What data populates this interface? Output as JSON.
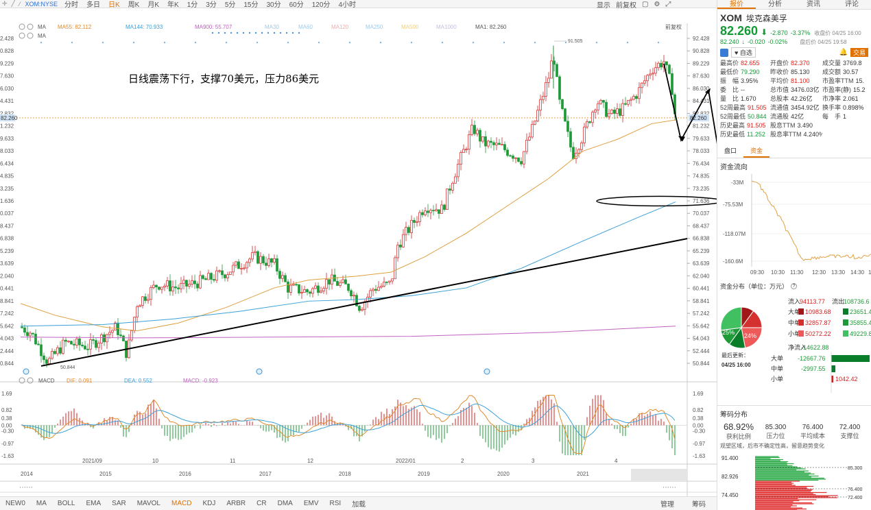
{
  "toolbar": {
    "symbol": "XOM:NYSE",
    "periods": [
      "分时",
      "多日",
      "日K",
      "周K",
      "月K",
      "年K",
      "1分",
      "3分",
      "5分",
      "15分",
      "30分",
      "60分",
      "120分",
      "4小时"
    ],
    "active_period": "日K",
    "right": [
      "显示",
      "前复权"
    ]
  },
  "main_chart": {
    "ma_legend": [
      {
        "label": "MA",
        "color": "#555"
      },
      {
        "label": "MA55: 82.112",
        "color": "#e08a2a"
      },
      {
        "label": "MA144: 70.933",
        "color": "#3aa0d8"
      },
      {
        "label": "MA900: 55.707",
        "color": "#c060c0"
      },
      {
        "label": "MA30",
        "color": "#9ec9e8"
      },
      {
        "label": "MA60",
        "color": "#9ec9e8"
      },
      {
        "label": "MA120",
        "color": "#e8b0b0"
      },
      {
        "label": "MA250",
        "color": "#9ec9e8"
      },
      {
        "label": "MA500",
        "color": "#f0d080"
      },
      {
        "label": "MA1000",
        "color": "#c0c0e0"
      },
      {
        "label": "MA1: 82.260",
        "color": "#555"
      }
    ],
    "ma_legend2": "MA",
    "fq_label": "前复权",
    "annotation": "日线震荡下行，支撑70美元，压力86美元",
    "y_ticks": [
      "92.428",
      "90.828",
      "89.229",
      "87.630",
      "86.030",
      "84.431",
      "82.832",
      "81.232",
      "79.633",
      "78.033",
      "76.434",
      "74.835",
      "73.235",
      "71.636",
      "70.037",
      "68.437",
      "66.838",
      "65.239",
      "63.639",
      "62.040",
      "60.441",
      "58.841",
      "57.242",
      "55.642",
      "54.043",
      "52.444",
      "50.844"
    ],
    "left_ticks": [
      "2.428",
      "0.828",
      "9.229",
      "7.630",
      "6.030",
      "4.431",
      "2.832",
      "1.232",
      "9.633",
      "8.033",
      "6.434",
      "4.835",
      "3.235",
      "1.636",
      "0.037",
      "8.437",
      "6.838",
      "5.239",
      "3.639",
      "2.040",
      "0.441",
      "8.841",
      "7.242",
      "5.642",
      "4.043",
      "2.444",
      "0.844"
    ],
    "current_price": "82.260",
    "high_label": "91.505",
    "low_label": "50.844"
  },
  "macd": {
    "title": "MACD",
    "dif": "DIF: 0.091",
    "dea": "DEA: 0.552",
    "macd": "MACD: -0.923",
    "y_ticks": [
      "1.69",
      "0.82",
      "0.38",
      "0.00",
      "-0.30",
      "-0.97",
      "-1.63"
    ]
  },
  "x_axis": {
    "labels_top": [
      "2021/09",
      "10",
      "11",
      "12",
      "2022/01",
      "2",
      "3",
      "4"
    ],
    "labels_bottom": [
      "2014",
      "2015",
      "2016",
      "2017",
      "2018",
      "2019",
      "2020",
      "2021",
      "2022"
    ]
  },
  "indicators": [
    "NEW0",
    "MA",
    "BOLL",
    "EMA",
    "SAR",
    "MAVOL",
    "MACD",
    "KDJ",
    "ARBR",
    "CR",
    "DMA",
    "EMV",
    "RSI",
    "加载"
  ],
  "active_indicator": "MACD",
  "bottom_right": [
    "管理",
    "筹码"
  ],
  "right_panel": {
    "tabs": [
      "报价",
      "分析",
      "资讯",
      "评论"
    ],
    "ticker": "XOM",
    "name": "埃克森美孚",
    "price": "82.260",
    "change": "-2.870",
    "pct": "-3.37%",
    "close_label": "收盘价 04/25 16:00",
    "after_price": "82.240",
    "after_change": "-0.020",
    "after_pct": "-0.02%",
    "after_label": "盘后价 04/25 19:58",
    "buttons": [
      "自选",
      "交易"
    ],
    "quotes": [
      [
        [
          "最高价",
          "82.655",
          "red"
        ],
        [
          "开盘价",
          "82.370",
          "red"
        ],
        [
          "成交量",
          "3769.8",
          "none"
        ]
      ],
      [
        [
          "最低价",
          "79.290",
          "green"
        ],
        [
          "昨收价",
          "85.130",
          "none"
        ],
        [
          "成交额",
          "30.57",
          "none"
        ]
      ],
      [
        [
          "振　幅",
          "3.95%",
          "none"
        ],
        [
          "平均价",
          "81.100",
          "red"
        ],
        [
          "市盈率TTM",
          "15.",
          "none"
        ]
      ],
      [
        [
          "委　比",
          "--",
          "none"
        ],
        [
          "总市值",
          "3476.03亿",
          "none"
        ],
        [
          "市盈率(静)",
          "15.2",
          "none"
        ]
      ],
      [
        [
          "量　比",
          "1.670",
          "none"
        ],
        [
          "总股本",
          "42.26亿",
          "none"
        ],
        [
          "市净率",
          "2.061",
          "none"
        ]
      ],
      [
        [
          "52周最高",
          "91.505",
          "red"
        ],
        [
          "流通值",
          "3454.92亿",
          "none"
        ],
        [
          "换手率",
          "0.898%",
          "none"
        ]
      ],
      [
        [
          "52周最低",
          "50.844",
          "green"
        ],
        [
          "流通股",
          "42亿",
          "none"
        ],
        [
          "每　手",
          "1",
          "none"
        ]
      ],
      [
        [
          "历史最高",
          "91.505",
          "red"
        ],
        [
          "股息TTM",
          "3.490",
          "none"
        ],
        [
          "",
          "",
          ""
        ]
      ],
      [
        [
          "历史最低",
          "11.252",
          "green"
        ],
        [
          "股息率TTM",
          "4.240%",
          "none"
        ],
        [
          "",
          "",
          ""
        ]
      ]
    ],
    "sub_tabs": [
      "盘口",
      "资金"
    ],
    "flow_title": "资金流向",
    "flow_y": [
      "-33M",
      "-75.53M",
      "-118.07M",
      "-160.6M"
    ],
    "flow_x": [
      "09:30",
      "10:30",
      "11:30",
      "12:30",
      "13:30",
      "14:30",
      "16"
    ],
    "dist_title": "资金分布（单位：万元）",
    "dist_head_in": "流入",
    "dist_in_total": "94113.77",
    "dist_head_out": "流出",
    "dist_out_total": "108736.6",
    "dist_rows": [
      {
        "label": "大单",
        "in": "10983.68",
        "out": "23651.43"
      },
      {
        "label": "中单",
        "in": "32857.87",
        "out": "35855.42"
      },
      {
        "label": "小单",
        "in": "50272.22",
        "out": "49229.8"
      }
    ],
    "pie_labels": [
      "25%",
      "24%"
    ],
    "net_label": "净流入",
    "net_value": "-14622.88",
    "update_label": "最后更新：",
    "update_time": "04/25 16:00",
    "net_rows": [
      {
        "label": "大单",
        "value": "-12667.76"
      },
      {
        "label": "中单",
        "value": "-2997.55"
      },
      {
        "label": "小单",
        "value": "1042.42"
      }
    ],
    "chip_title": "筹码分布",
    "chip_stats": [
      {
        "value": "68.92%",
        "label": "获利比例"
      },
      {
        "value": "85.300",
        "label": "压力位"
      },
      {
        "value": "76.400",
        "label": "平均成本"
      },
      {
        "value": "72.400",
        "label": "支撑位"
      }
    ],
    "chip_note": "观望区域，后市不确定性高，留意趋势变化",
    "chip_y": [
      "91.400",
      "82.926",
      "74.450",
      "65.975"
    ],
    "chip_marks": [
      "85.300",
      "76.400",
      "72.400"
    ]
  }
}
